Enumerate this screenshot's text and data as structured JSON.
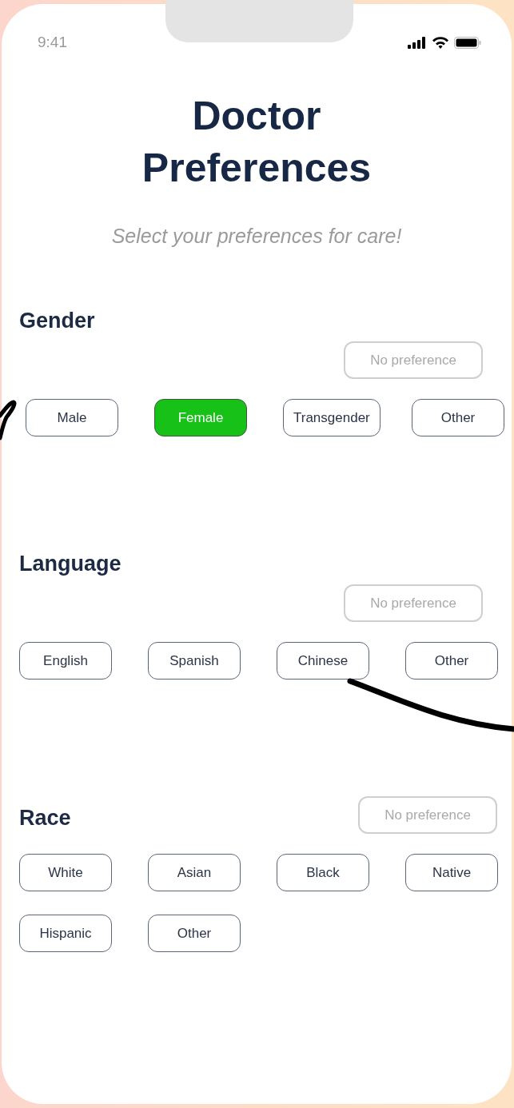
{
  "status_bar": {
    "time": "9:41"
  },
  "title": "Doctor Preferences",
  "subtitle": "Select your preferences for care!",
  "sections": [
    {
      "label": "Gender",
      "no_preference": {
        "label": "No preference",
        "selected": false
      },
      "options": [
        {
          "label": "Male",
          "selected": false
        },
        {
          "label": "Female",
          "selected": true
        },
        {
          "label": "Transgender",
          "selected": false
        },
        {
          "label": "Other",
          "selected": false
        }
      ]
    },
    {
      "label": "Language",
      "no_preference": {
        "label": "No preference",
        "selected": false
      },
      "options": [
        {
          "label": "English",
          "selected": false
        },
        {
          "label": "Spanish",
          "selected": false
        },
        {
          "label": "Chinese",
          "selected": false
        },
        {
          "label": "Other",
          "selected": false
        }
      ]
    },
    {
      "label": "Race",
      "no_preference": {
        "label": "No preference",
        "selected": false
      },
      "options": [
        {
          "label": "White",
          "selected": false
        },
        {
          "label": "Asian",
          "selected": false
        },
        {
          "label": "Black",
          "selected": false
        },
        {
          "label": "Native",
          "selected": false
        },
        {
          "label": "Hispanic",
          "selected": false
        },
        {
          "label": "Other",
          "selected": false
        }
      ]
    }
  ]
}
